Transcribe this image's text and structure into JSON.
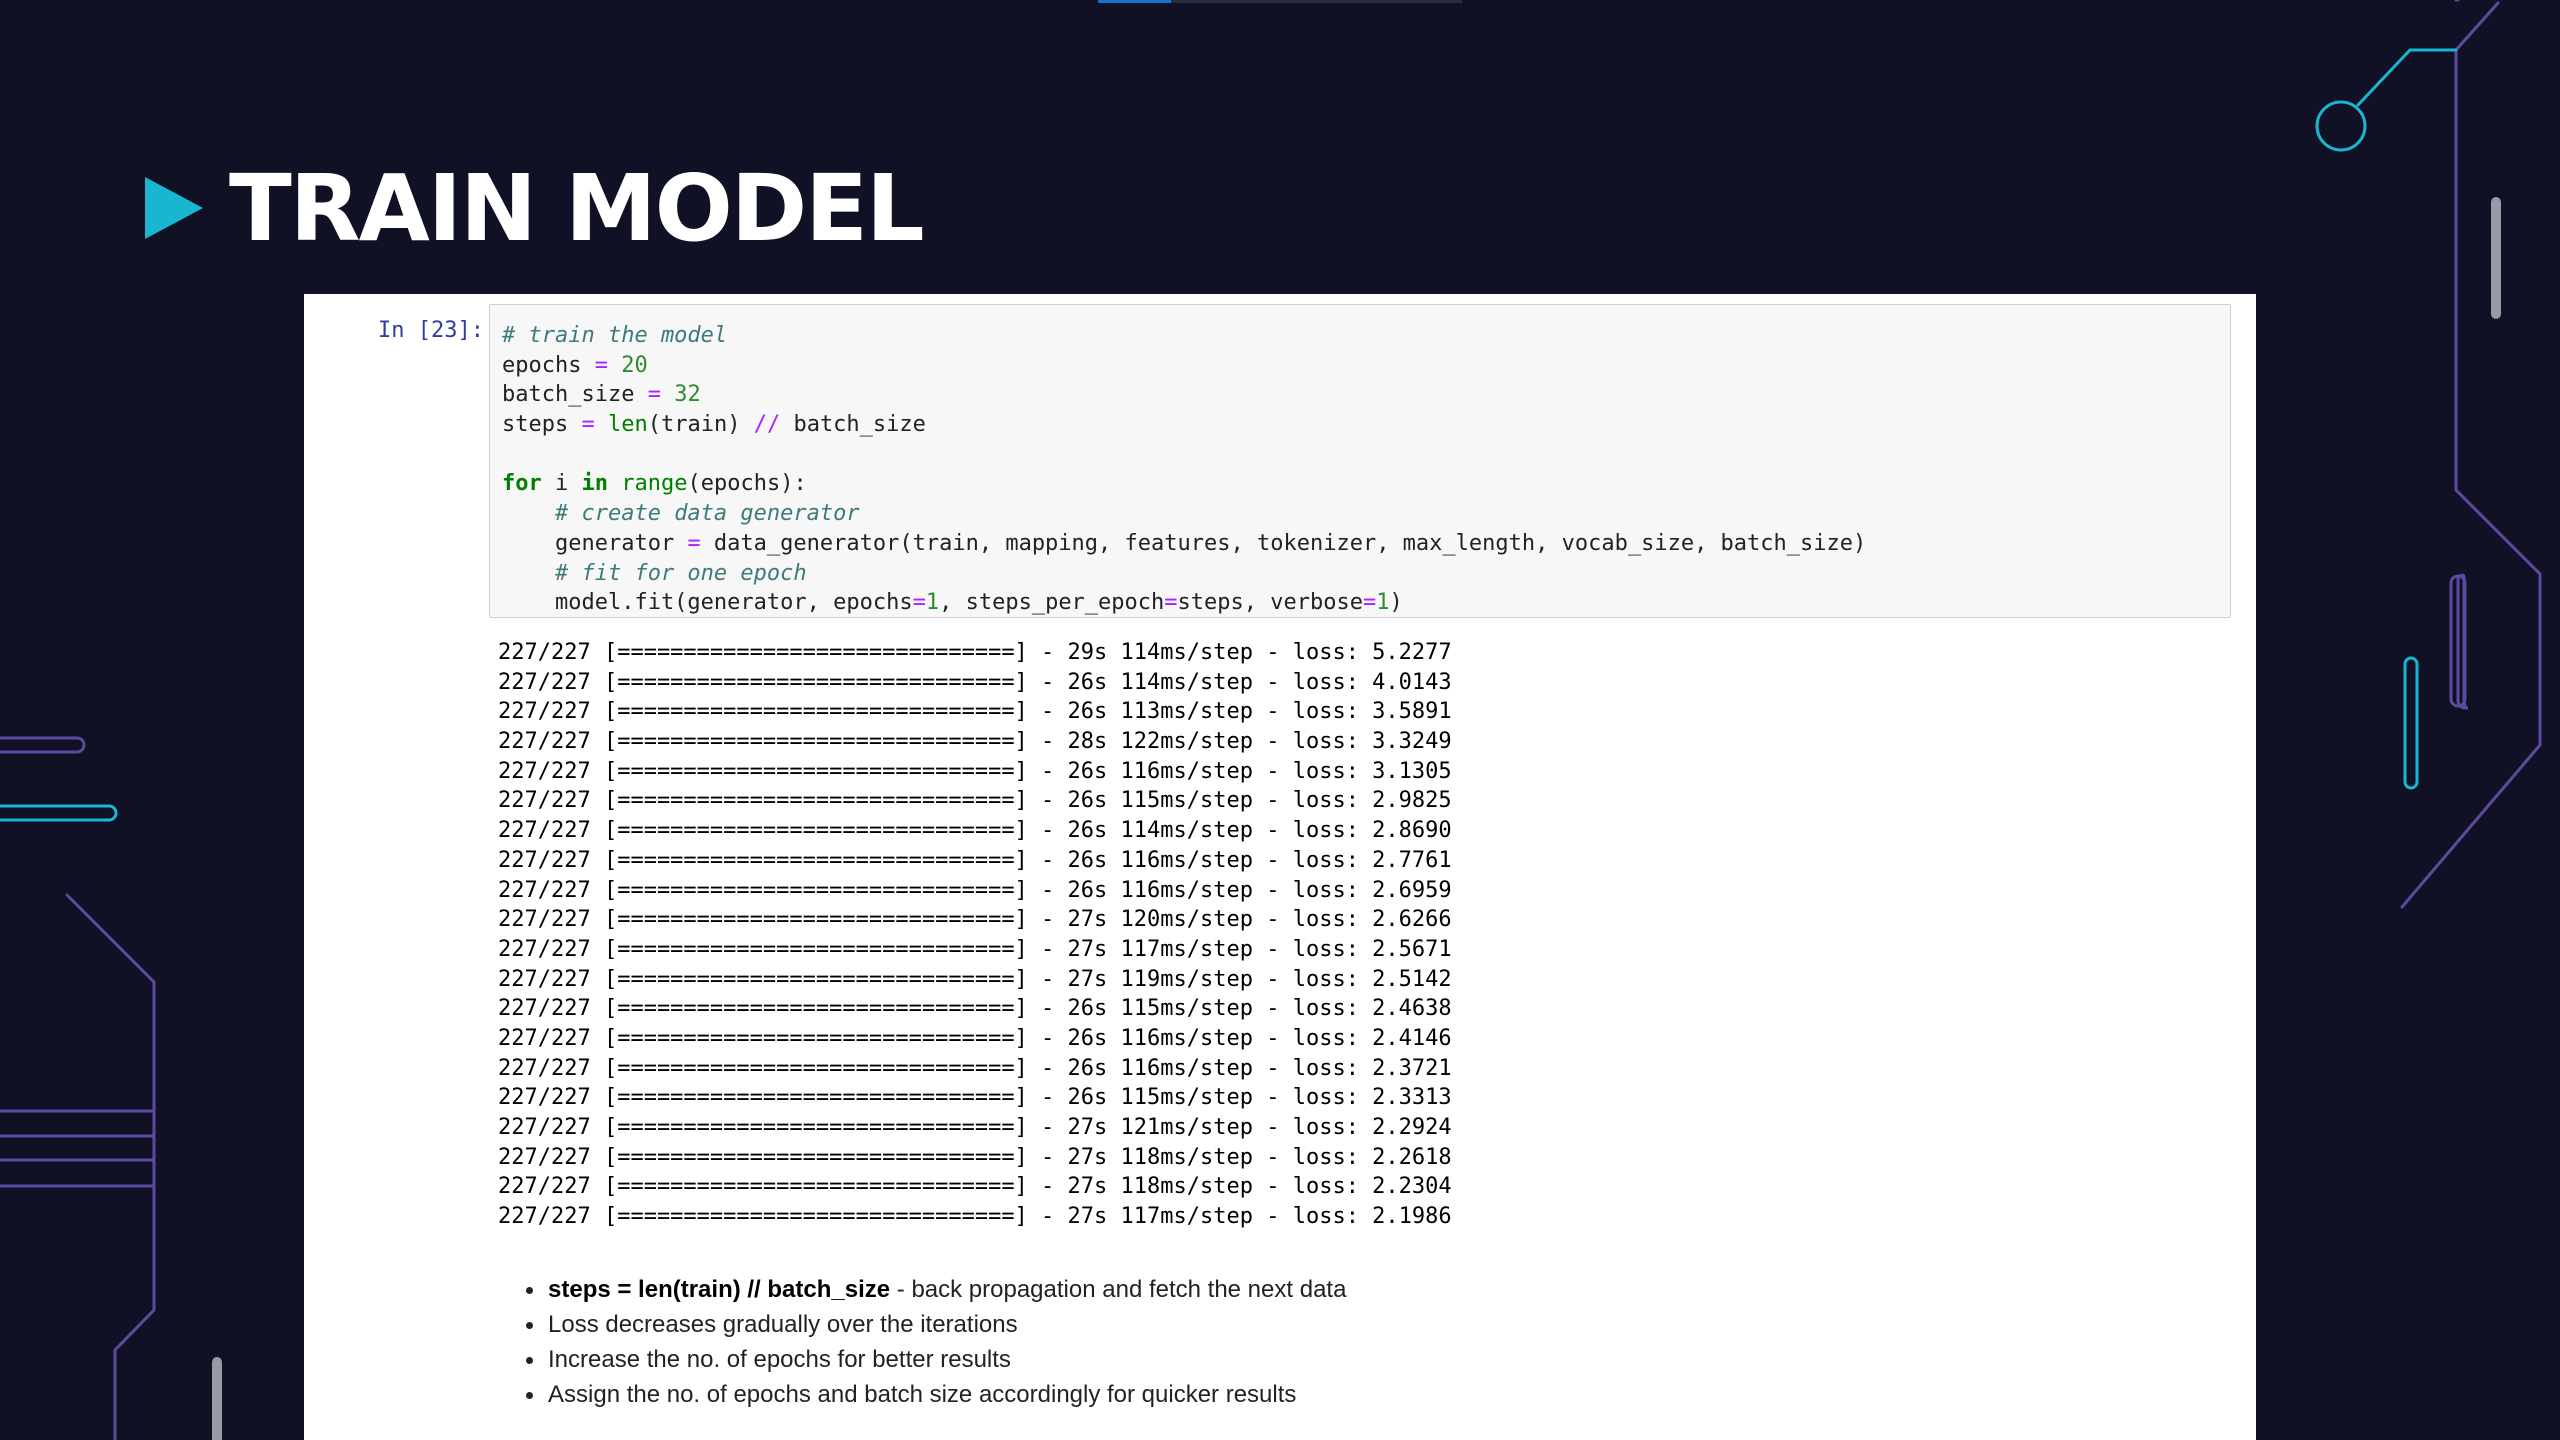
{
  "slide": {
    "title": "TRAIN MODEL",
    "colors": {
      "background": "#111126",
      "accent_cyan": "#19b6d1",
      "accent_purple": "#5b4a9e",
      "panel": "#ffffff"
    },
    "title_icon": "play-triangle-icon"
  },
  "cell": {
    "prompt": "In [23]:",
    "code": [
      "# train the model",
      "epochs = 20",
      "batch_size = 32",
      "steps = len(train) // batch_size",
      "",
      "for i in range(epochs):",
      "    # create data generator",
      "    generator = data_generator(train, mapping, features, tokenizer, max_length, vocab_size, batch_size)",
      "    # fit for one epoch",
      "    model.fit(generator, epochs=1, steps_per_epoch=steps, verbose=1)"
    ],
    "output": [
      "227/227 [==============================] - 29s 114ms/step - loss: 5.2277",
      "227/227 [==============================] - 26s 114ms/step - loss: 4.0143",
      "227/227 [==============================] - 26s 113ms/step - loss: 3.5891",
      "227/227 [==============================] - 28s 122ms/step - loss: 3.3249",
      "227/227 [==============================] - 26s 116ms/step - loss: 3.1305",
      "227/227 [==============================] - 26s 115ms/step - loss: 2.9825",
      "227/227 [==============================] - 26s 114ms/step - loss: 2.8690",
      "227/227 [==============================] - 26s 116ms/step - loss: 2.7761",
      "227/227 [==============================] - 26s 116ms/step - loss: 2.6959",
      "227/227 [==============================] - 27s 120ms/step - loss: 2.6266",
      "227/227 [==============================] - 27s 117ms/step - loss: 2.5671",
      "227/227 [==============================] - 27s 119ms/step - loss: 2.5142",
      "227/227 [==============================] - 26s 115ms/step - loss: 2.4638",
      "227/227 [==============================] - 26s 116ms/step - loss: 2.4146",
      "227/227 [==============================] - 26s 116ms/step - loss: 2.3721",
      "227/227 [==============================] - 26s 115ms/step - loss: 2.3313",
      "227/227 [==============================] - 27s 121ms/step - loss: 2.2924",
      "227/227 [==============================] - 27s 118ms/step - loss: 2.2618",
      "227/227 [==============================] - 27s 118ms/step - loss: 2.2304",
      "227/227 [==============================] - 27s 117ms/step - loss: 2.1986"
    ]
  },
  "notes": {
    "first_bold": "steps = len(train) // batch_size",
    "first_rest": " - back propagation and fetch the next data",
    "items": [
      "Loss decreases gradually over the iterations",
      "Increase the no. of epochs for better results",
      "Assign the no. of epochs and batch size accordingly for quicker results"
    ]
  },
  "progress": {
    "fraction": 0.2
  }
}
